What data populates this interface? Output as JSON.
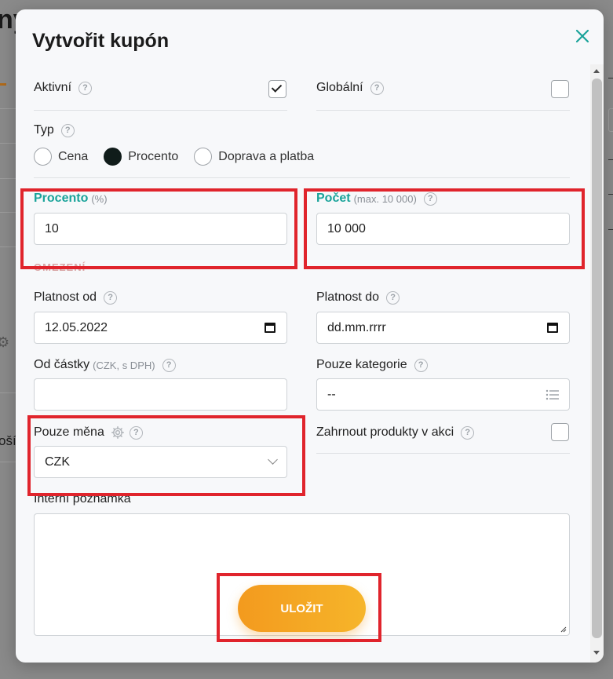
{
  "background": {
    "title_fragment": "ny",
    "side_text_fragment": "ošíl"
  },
  "modal": {
    "title": "Vytvořit kupón"
  },
  "aktivni": {
    "label": "Aktivní",
    "checked": true
  },
  "globalni": {
    "label": "Globální",
    "checked": false
  },
  "typ": {
    "label": "Typ",
    "options": [
      "Cena",
      "Procento",
      "Doprava a platba"
    ],
    "selected": "Procento"
  },
  "procento": {
    "label": "Procento",
    "hint": "(%)",
    "value": "10"
  },
  "pocet": {
    "label": "Počet",
    "hint": "(max. 10 000)",
    "value": "10 000"
  },
  "omezeni": {
    "title": "OMEZENÍ"
  },
  "platnost_od": {
    "label": "Platnost od",
    "value": "12.05.2022"
  },
  "platnost_do": {
    "label": "Platnost do",
    "placeholder": "dd.mm.rrrr"
  },
  "od_castky": {
    "label": "Od částky",
    "hint": "(CZK, s DPH)",
    "value": ""
  },
  "pouze_kategorie": {
    "label": "Pouze kategorie",
    "value": "--"
  },
  "pouze_mena": {
    "label": "Pouze měna",
    "value": "CZK"
  },
  "zahrnout": {
    "label": "Zahrnout produkty v akci",
    "checked": false
  },
  "poznamka": {
    "label": "Interní poznámka",
    "value": ""
  },
  "save": {
    "label": "ULOŽIT"
  },
  "colors": {
    "accent_teal": "#1aa39a",
    "button_orange": "#f39a1e",
    "highlight_red": "#e0242c"
  }
}
